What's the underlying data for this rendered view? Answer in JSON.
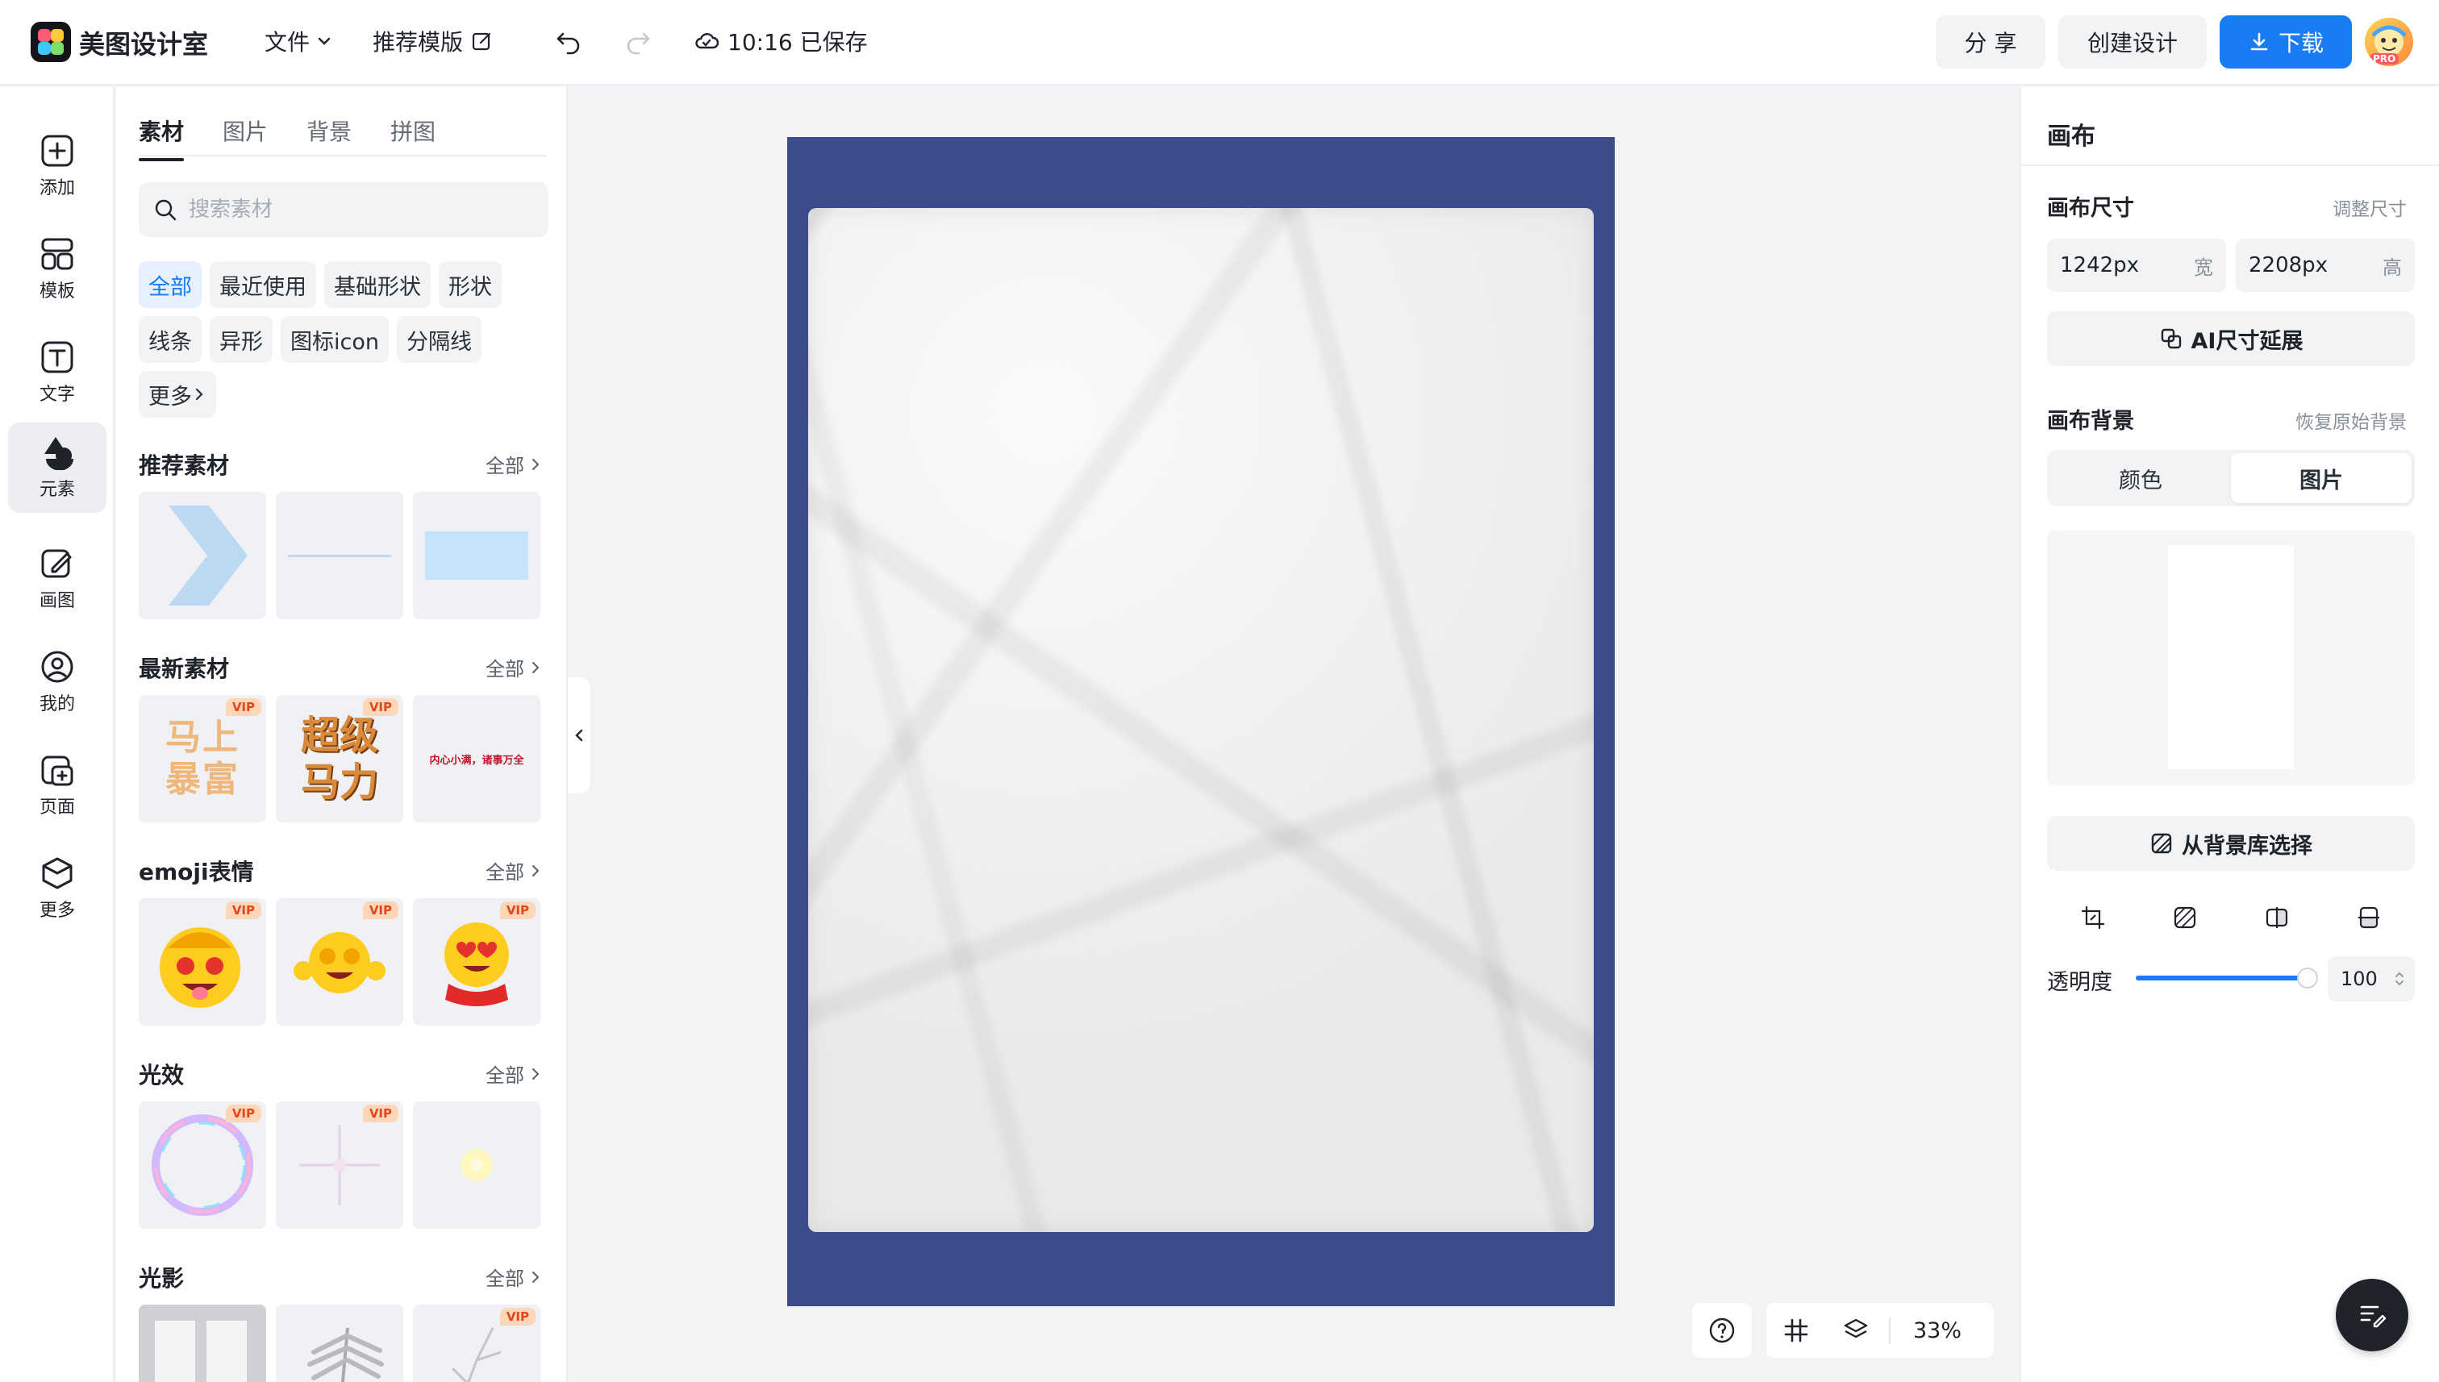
{
  "header": {
    "app_name": "美图设计室",
    "menu_file": "文件",
    "menu_template": "推荐模版",
    "save_status": "10:16 已保存",
    "share_label": "分 享",
    "create_label": "创建设计",
    "download_label": "下载",
    "avatar_badge": "PRO"
  },
  "rail": {
    "items": [
      {
        "label": "添加",
        "icon": "plus-square-icon"
      },
      {
        "label": "模板",
        "icon": "template-icon"
      },
      {
        "label": "文字",
        "icon": "text-icon"
      },
      {
        "label": "元素",
        "icon": "shapes-icon"
      },
      {
        "label": "画图",
        "icon": "draw-icon"
      },
      {
        "label": "我的",
        "icon": "user-icon"
      },
      {
        "label": "页面",
        "icon": "page-icon"
      },
      {
        "label": "更多",
        "icon": "cube-icon"
      }
    ],
    "active_index": 3
  },
  "assets": {
    "tabs": [
      "素材",
      "图片",
      "背景",
      "拼图"
    ],
    "active_tab": 0,
    "search_placeholder": "搜索素材",
    "chips": [
      "全部",
      "最近使用",
      "基础形状",
      "形状",
      "线条",
      "异形",
      "图标icon",
      "分隔线",
      "更多"
    ],
    "all_label": "全部",
    "vip_label": "VIP",
    "sections": [
      {
        "title": "推荐素材"
      },
      {
        "title": "最新素材",
        "thumb_texts": [
          "马上暴富",
          "超级马力",
          "内心小满，诸事万全"
        ]
      },
      {
        "title": "emoji表情"
      },
      {
        "title": "光效"
      },
      {
        "title": "光影"
      }
    ]
  },
  "canvas": {
    "background_color": "#3d4b8a",
    "zoom": "33%"
  },
  "props": {
    "title": "画布",
    "size_label": "画布尺寸",
    "resize_link": "调整尺寸",
    "width_value": "1242px",
    "width_unit": "宽",
    "height_value": "2208px",
    "height_unit": "高",
    "ai_extend": "AI尺寸延展",
    "bg_label": "画布背景",
    "restore_link": "恢复原始背景",
    "seg_color": "颜色",
    "seg_image": "图片",
    "library_btn": "从背景库选择",
    "opacity_label": "透明度",
    "opacity_value": "100"
  },
  "colors": {
    "accent": "#1a7cf5",
    "vip_bg": "#ffd7b8",
    "vip_text": "#e2461c"
  }
}
